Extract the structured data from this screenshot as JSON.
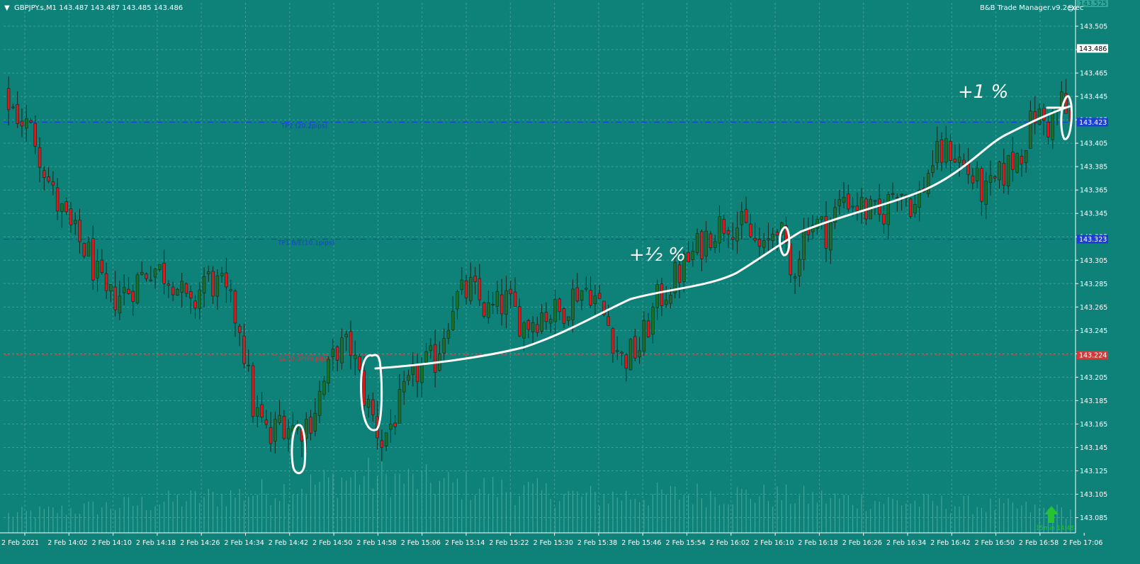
{
  "header": {
    "symbol_info": "GBPJPY.s,M1  143.487 143.487 143.485 143.486",
    "manager": "B&B Trade Manager.v9.2exec"
  },
  "colors": {
    "background": "#0e8178",
    "bull": "#1f6e28",
    "bear": "#d81b1b",
    "tp_line": "#1a3fd6",
    "sl_line": "#d33a3a",
    "grid": "#5fb0a8"
  },
  "levels": {
    "tp2": {
      "price": 143.423,
      "label": "TP2 (20.2pips)",
      "tag": "143.423"
    },
    "tp1": {
      "price": 143.323,
      "label": "TP1 B/E(10.1pips)",
      "tag": "143.323"
    },
    "sl": {
      "price": 143.224,
      "label": "SL (0.3PIPs pips)",
      "tag": "143.224"
    },
    "current": {
      "price": 143.486,
      "tag": "143.486"
    },
    "top_tag": "143.525"
  },
  "indicator": {
    "icon": "green-up-arrow-icon",
    "label": "15min 14:48"
  },
  "annotations": {
    "half_percent": "+½ %",
    "one_percent": "+1 %"
  },
  "chart_data": {
    "type": "candlestick",
    "symbol": "GBPJPY.s",
    "timeframe": "M1",
    "ylim": [
      143.072,
      143.525
    ],
    "y_ticks": [
      143.505,
      143.485,
      143.465,
      143.445,
      143.425,
      143.405,
      143.385,
      143.365,
      143.345,
      143.325,
      143.305,
      143.285,
      143.265,
      143.245,
      143.225,
      143.205,
      143.185,
      143.165,
      143.145,
      143.125,
      143.105,
      143.085
    ],
    "x_ticks": [
      "2 Feb 2021",
      "2 Feb 14:02",
      "2 Feb 14:10",
      "2 Feb 14:18",
      "2 Feb 14:26",
      "2 Feb 14:34",
      "2 Feb 14:42",
      "2 Feb 14:50",
      "2 Feb 14:58",
      "2 Feb 15:06",
      "2 Feb 15:14",
      "2 Feb 15:22",
      "2 Feb 15:30",
      "2 Feb 15:38",
      "2 Feb 15:46",
      "2 Feb 15:54",
      "2 Feb 16:02",
      "2 Feb 16:10",
      "2 Feb 16:18",
      "2 Feb 16:26",
      "2 Feb 16:34",
      "2 Feb 16:42",
      "2 Feb 16:50",
      "2 Feb 16:58",
      "2 Feb 17:06"
    ],
    "grid": true,
    "close_path": [
      [
        0,
        143.44
      ],
      [
        6,
        143.41
      ],
      [
        10,
        143.36
      ],
      [
        14,
        143.33
      ],
      [
        18,
        143.31
      ],
      [
        22,
        143.27
      ],
      [
        27,
        143.28
      ],
      [
        32,
        143.3
      ],
      [
        37,
        143.29
      ],
      [
        41,
        143.26
      ],
      [
        44,
        143.29
      ],
      [
        48,
        143.28
      ],
      [
        52,
        143.25
      ],
      [
        55,
        143.18
      ],
      [
        59,
        143.15
      ],
      [
        61,
        143.17
      ],
      [
        65,
        143.16
      ],
      [
        68,
        143.17
      ],
      [
        71,
        143.2
      ],
      [
        74,
        143.23
      ],
      [
        77,
        143.23
      ],
      [
        80,
        143.19
      ],
      [
        84,
        143.15
      ],
      [
        88,
        143.18
      ],
      [
        92,
        143.21
      ],
      [
        96,
        143.22
      ],
      [
        100,
        143.27
      ],
      [
        104,
        143.28
      ],
      [
        108,
        143.26
      ],
      [
        112,
        143.27
      ],
      [
        116,
        143.25
      ],
      [
        120,
        143.26
      ],
      [
        124,
        143.26
      ],
      [
        128,
        143.28
      ],
      [
        131,
        143.28
      ],
      [
        135,
        143.25
      ],
      [
        138,
        143.22
      ],
      [
        142,
        143.23
      ],
      [
        146,
        143.27
      ],
      [
        150,
        143.29
      ],
      [
        154,
        143.31
      ],
      [
        158,
        143.33
      ],
      [
        162,
        143.34
      ],
      [
        166,
        143.33
      ],
      [
        170,
        143.31
      ],
      [
        173,
        143.34
      ],
      [
        176,
        143.29
      ],
      [
        180,
        143.34
      ],
      [
        184,
        143.33
      ],
      [
        188,
        143.36
      ],
      [
        192,
        143.35
      ],
      [
        196,
        143.34
      ],
      [
        200,
        143.37
      ],
      [
        204,
        143.35
      ],
      [
        208,
        143.39
      ],
      [
        212,
        143.4
      ],
      [
        216,
        143.38
      ],
      [
        220,
        143.36
      ],
      [
        224,
        143.38
      ],
      [
        228,
        143.4
      ],
      [
        231,
        143.43
      ],
      [
        234,
        143.42
      ],
      [
        237,
        143.44
      ],
      [
        239,
        143.42
      ]
    ],
    "volume_profile": [
      [
        0,
        30
      ],
      [
        40,
        55
      ],
      [
        60,
        70
      ],
      [
        80,
        95
      ],
      [
        100,
        80
      ],
      [
        130,
        60
      ],
      [
        160,
        65
      ],
      [
        190,
        55
      ],
      [
        220,
        45
      ],
      [
        239,
        35
      ]
    ]
  }
}
